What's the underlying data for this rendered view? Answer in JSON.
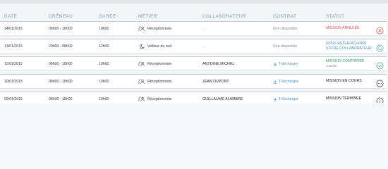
{
  "columns": {
    "date": "DATE",
    "creneau": "CRÉNEAU",
    "duree": "DURÉE",
    "metier": "MÉTIER",
    "collaborateur": "COLLABORATEUR",
    "contrat": "CONTRAT",
    "statut": "STATUT"
  },
  "rows": [
    {
      "date": "14/01/2015",
      "creneau": "08h00 - 18h00",
      "duree": "10h00",
      "metier": "Réceptionniste",
      "metier_icon": "receptionist-icon",
      "collaborateur": "...",
      "contrat": "Non disponible",
      "statut_line1": "MISSION ANNULÉE",
      "statut_line2": "",
      "status_color": "#d94b4b",
      "action_icon": "cancel-circle-icon"
    },
    {
      "date": "13/01/2015",
      "creneau": "20h00 - 08h00",
      "duree": "12h00",
      "metier": "Veilleur de nuit",
      "metier_icon": "moon-icon",
      "collaborateur": "...",
      "contrat": "Non disponible",
      "statut_line1": "NOUS RECHERCHONS",
      "statut_line2": "VOTRE COLLABORATEUR",
      "status_color": "#4e93c6",
      "action_icon": "refresh-circle-icon"
    },
    {
      "date": "11/01/2015",
      "creneau": "08h00 - 18h00",
      "duree": "10h00",
      "metier": "Réceptionniste",
      "metier_icon": "receptionist-icon",
      "collaborateur": "ANTOINE MICHEL",
      "contrat": "Télécharger",
      "statut_line1": "MISSION CONFIRMÉE",
      "statut_line2": "Annuler",
      "status_color": "#3ba37a",
      "action_icon": "check-circle-icon"
    },
    {
      "date": "10/01/2015",
      "creneau": "08h00 - 18h00",
      "duree": "10h00",
      "metier": "Réceptionniste",
      "metier_icon": "receptionist-icon",
      "collaborateur": "JEAN DUPONT",
      "contrat": "Télécharger",
      "statut_line1": "MISSION EN COURS",
      "statut_line2": "",
      "status_color": "#222222",
      "action_icon": "more-circle-icon"
    },
    {
      "date": "09/01/2015",
      "creneau": "08h00 - 18h00",
      "duree": "10h00",
      "metier": "Réceptionniste",
      "metier_icon": "receptionist-icon",
      "collaborateur": "GUILLAUME ALAMBRE",
      "contrat": "Télécharger",
      "statut_line1": "MISSION TERMINÉE",
      "statut_line2": "",
      "status_color": "#222222",
      "action_icon": "info-circle-icon"
    }
  ]
}
